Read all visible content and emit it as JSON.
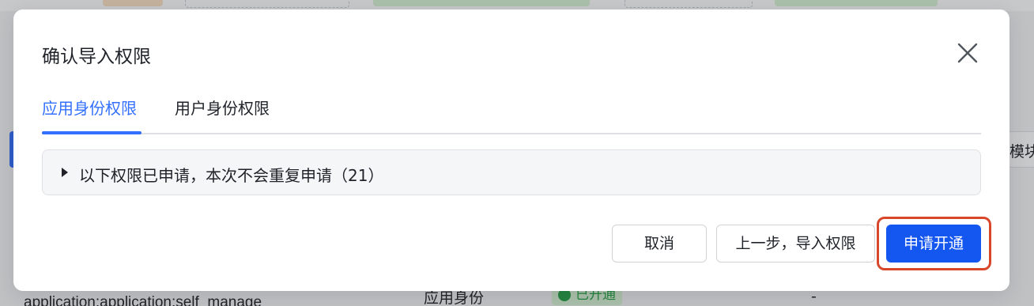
{
  "background": {
    "side_button_label": "模块",
    "bottom_text": "application:application:self_manage",
    "role_label": "应用身份",
    "status_label": "已开通",
    "dash": "-"
  },
  "dialog": {
    "title": "确认导入权限",
    "close_icon": "close-icon",
    "tabs": [
      {
        "label": "应用身份权限",
        "active": true
      },
      {
        "label": "用户身份权限",
        "active": false
      }
    ],
    "panel": {
      "text": "以下权限已申请，本次不会重复申请（21）",
      "expanded": false,
      "icon": "caret-right-icon"
    },
    "buttons": {
      "cancel": "取消",
      "prev": "上一步，导入权限",
      "submit": "申请开通"
    }
  },
  "colors": {
    "accent": "#3370ff",
    "primary_button": "#1456f0",
    "highlight": "#d9472b",
    "text": "#1f2329"
  }
}
